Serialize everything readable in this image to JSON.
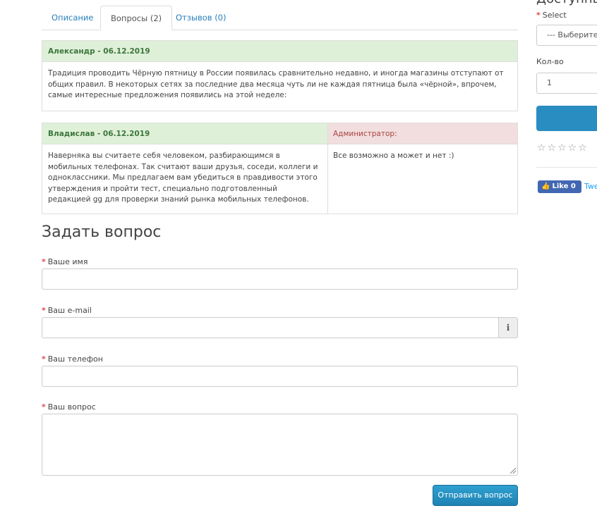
{
  "tabs": [
    {
      "label": "Описание"
    },
    {
      "label": "Вопросы (2)"
    },
    {
      "label": "Отзывов (0)"
    }
  ],
  "questions": [
    {
      "author_date": "Александр - 06.12.2019",
      "text": "Традиция проводить Чёрную пятницу в России появилась сравнительно недавно, и иногда магазины отступают от общих правил. В некоторых сетях за последние два месяца чуть ли не каждая пятница была «чёрной», впрочем, самые интересные предложения появились на этой неделе:"
    },
    {
      "author_date": "Владислав - 06.12.2019",
      "text": "Наверняка вы считаете себя человеком, разбирающимся в мобильных телефонах. Так считают ваши друзья, соседи, коллеги и одноклассники. Мы предлагаем вам убедиться в правдивости этого утверждения и пройти тест, специально подготовленный редакцией gg для проверки знаний рынка мобильных телефонов.",
      "admin_label": "Администратор:",
      "admin_text": "Все возможно а может и нет :)"
    }
  ],
  "form": {
    "title": "Задать вопрос",
    "required_mark": "*",
    "name_label": "Ваше имя",
    "email_label": "Ваш e-mail",
    "email_addon": "i",
    "phone_label": "Ваш телефон",
    "question_label": "Ваш вопрос",
    "submit_label": "Отправить вопрос"
  },
  "sidebar": {
    "heading": "Доступны",
    "select_label": "Select",
    "select_value": "--- Выберите ---",
    "qty_label": "Кол-во",
    "qty_value": "1",
    "stars": "☆☆☆☆☆",
    "fb_like": "Like",
    "fb_count": "0",
    "tweet": "Tweet",
    "button_color": "#2a8dc2"
  }
}
